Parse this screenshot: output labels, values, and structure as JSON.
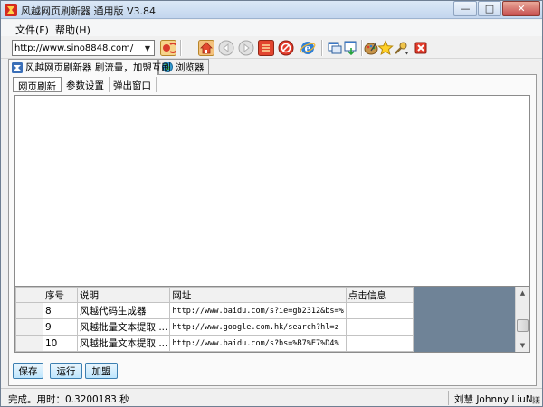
{
  "window": {
    "title": "风越网页刷新器 通用版 V3.84",
    "controls": {
      "minimize": "—",
      "maximize": "□",
      "close": "✕"
    }
  },
  "menu": [
    {
      "label": "文件(F)"
    },
    {
      "label": "帮助(H)"
    }
  ],
  "address": {
    "value": "http://www.sino8848.com/",
    "dropdown_glyph": "▼"
  },
  "toolbar_icons": [
    "go-icon",
    "home-icon",
    "back-icon",
    "forward-icon",
    "refresh-icon",
    "stop-icon",
    "ie-icon",
    "window-icon",
    "save-page-icon",
    "palette-icon",
    "favorite-star-icon",
    "tools-icon",
    "exit-icon"
  ],
  "tabs": {
    "outer": [
      {
        "label": "风越网页刷新器 刷流量，加盟互刷",
        "active": true
      },
      {
        "label": "浏览器",
        "active": false
      }
    ],
    "inner": [
      {
        "label": "网页刷新",
        "active": true
      },
      {
        "label": "参数设置",
        "active": false
      },
      {
        "label": "弹出窗口",
        "active": false
      }
    ]
  },
  "grid": {
    "columns": [
      "序号",
      "说明",
      "网址",
      "点击信息"
    ],
    "rows": [
      [
        "8",
        "风越代码生成器",
        "http://www.baidu.com/s?ie=gb2312&bs=%",
        ""
      ],
      [
        "9",
        "风越批量文本提取 ...",
        "http://www.google.com.hk/search?hl=z",
        ""
      ],
      [
        "10",
        "风越批量文本提取 ...",
        "http://www.baidu.com/s?bs=%B7%E7%D4%",
        ""
      ]
    ]
  },
  "buttons": {
    "save": "保存",
    "run": "运行",
    "join": "加盟"
  },
  "status": {
    "text": "完成。用时：0.3200183 秒",
    "author": "刘慧 Johnny LiuNu"
  },
  "colors": {
    "grid_empty_bg": "#6f8397",
    "button_border": "#3c7fb1",
    "close_button": "#c75050"
  }
}
